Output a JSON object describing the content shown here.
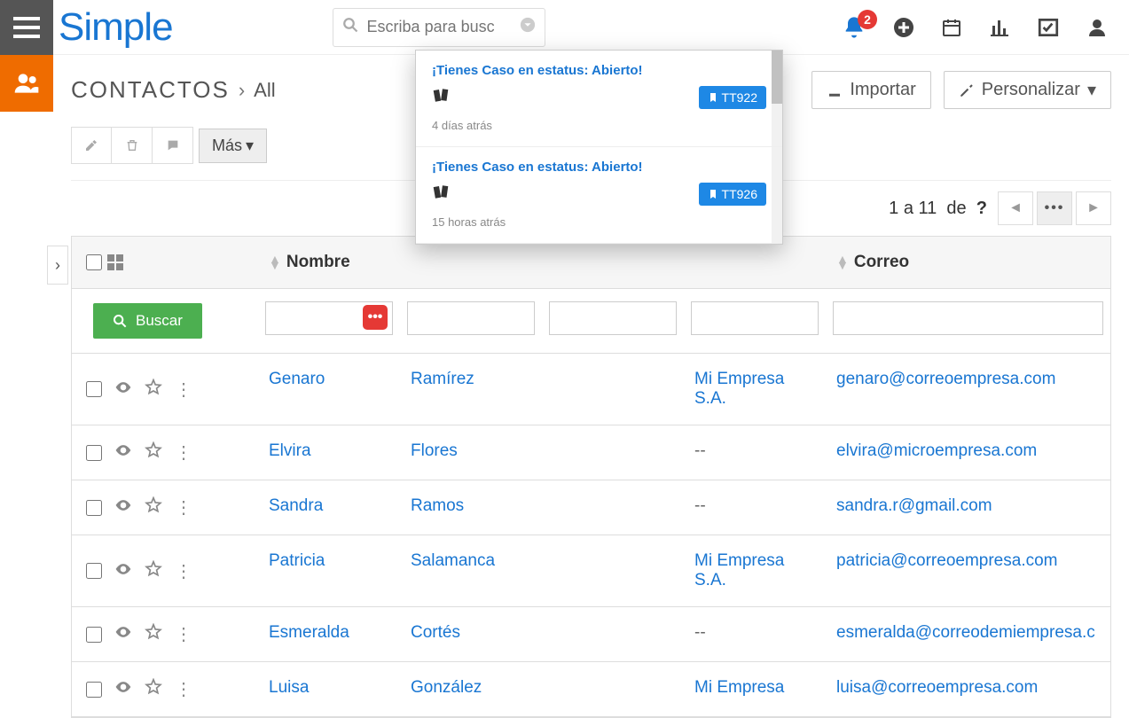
{
  "logo": "Simple",
  "search": {
    "placeholder": "Escriba para busc"
  },
  "notif_count": "2",
  "notifications": [
    {
      "title": "¡Tienes Caso en estatus: Abierto!",
      "tag": "TT922",
      "time": "4 días atrás"
    },
    {
      "title": "¡Tienes Caso en estatus: Abierto!",
      "tag": "TT926",
      "time": "15 horas atrás"
    }
  ],
  "page": {
    "title": "CONTACTOS",
    "crumb": "All"
  },
  "actions": {
    "import": "Importar",
    "customize": "Personalizar"
  },
  "toolbar": {
    "mas": "Más"
  },
  "pager": {
    "range": "1 a 11",
    "of": "de",
    "unknown": "?"
  },
  "columns": {
    "name": "Nombre",
    "email": "Correo"
  },
  "search_btn": "Buscar",
  "rows": [
    {
      "first": "Genaro",
      "last": "Ramírez",
      "company": "Mi Empresa S.A.",
      "email": "genaro@correoempresa.com"
    },
    {
      "first": "Elvira",
      "last": "Flores",
      "company": "--",
      "email": "elvira@microempresa.com"
    },
    {
      "first": "Sandra",
      "last": "Ramos",
      "company": "--",
      "email": "sandra.r@gmail.com"
    },
    {
      "first": "Patricia",
      "last": "Salamanca",
      "company": "Mi Empresa S.A.",
      "email": "patricia@correoempresa.com"
    },
    {
      "first": "Esmeralda",
      "last": "Cortés",
      "company": "--",
      "email": "esmeralda@correodemiempresa.c"
    },
    {
      "first": "Luisa",
      "last": "González",
      "company": "Mi Empresa",
      "email": "luisa@correoempresa.com"
    }
  ]
}
